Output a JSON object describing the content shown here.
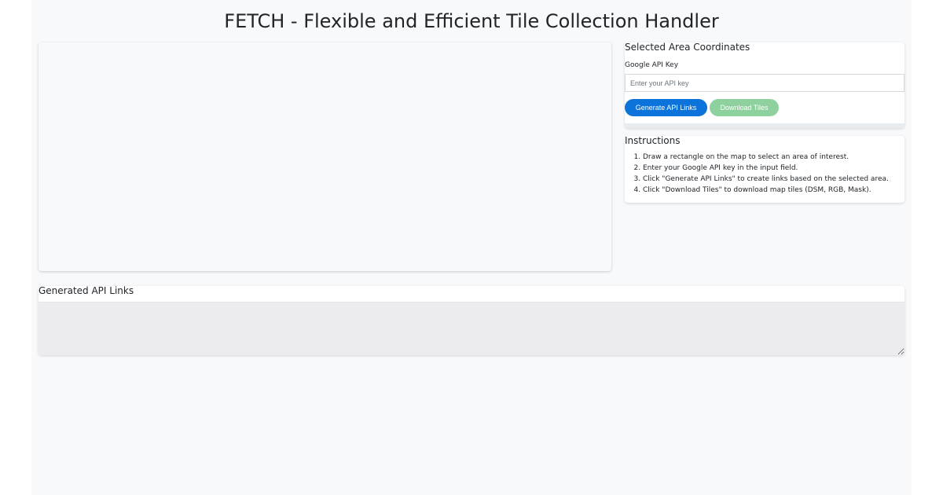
{
  "header": {
    "title": "FETCH - Flexible and Efficient Tile Collection Handler"
  },
  "coordinates_panel": {
    "heading": "Selected Area Coordinates",
    "api_key_label": "Google API Key",
    "api_key_value": "",
    "api_key_placeholder": "Enter your API key",
    "generate_label": "Generate API Links",
    "download_label": "Download Tiles"
  },
  "instructions": {
    "heading": "Instructions",
    "steps": [
      "Draw a rectangle on the map to select an area of interest.",
      "Enter your Google API key in the input field.",
      "Click \"Generate API Links\" to create links based on the selected area.",
      "Click \"Download Tiles\" to download map tiles (DSM, RGB, Mask)."
    ]
  },
  "links_panel": {
    "heading": "Generated API Links",
    "value": ""
  },
  "colors": {
    "page_background": "#f8f9fa",
    "generate_button": "#0b73d9",
    "download_button": "#8fd19e",
    "links_area": "#ececee"
  }
}
